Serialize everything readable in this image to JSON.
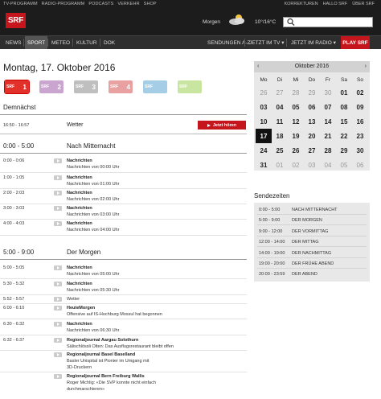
{
  "top_links_left": [
    "TV-PROGRAMM",
    "RADIO-PROGRAMM",
    "PODCASTS",
    "VERKEHR",
    "SHOP"
  ],
  "top_links_right": [
    "KORREKTUREN",
    "HALLO SRF",
    "ÜBER SRF"
  ],
  "logo": "SRF",
  "weather": {
    "label": "Morgen",
    "temp": "10°/16°C",
    "icon": "cloud-sun-icon"
  },
  "search": {
    "placeholder": "",
    "icon": "search-icon"
  },
  "nav_left": [
    "NEWS",
    "SPORT",
    "METEO",
    "KULTUR",
    "DOK"
  ],
  "nav_active": "SPORT",
  "nav_right": [
    "SENDUNGEN A-Z",
    "JETZT IM TV ▾",
    "JETZT IM RADIO ▾"
  ],
  "nav_play": "PLAY SRF",
  "date_title": "Montag, 17. Oktober 2016",
  "channels": [
    {
      "name": "SRF 1",
      "digit": "1"
    },
    {
      "name": "SRF 2",
      "digit": "2"
    },
    {
      "name": "SRF 3",
      "digit": "3"
    },
    {
      "name": "SRF 4",
      "digit": "4"
    },
    {
      "name": "SRF Musikwelle",
      "digit": ""
    },
    {
      "name": "SRF Virus",
      "digit": ""
    }
  ],
  "demnaechst": {
    "heading": "Demnächst",
    "time": "16:50 - 16:57",
    "title": "Wetter",
    "button": "Jetzt hören"
  },
  "block1": {
    "time": "0:00 - 5:00",
    "title": "Nach Mitternacht",
    "rows": [
      {
        "time": "0:00 - 0:06",
        "title": "Nachrichten",
        "sub": "Nachrichten von 00:00 Uhr"
      },
      {
        "time": "1:00 - 1:05",
        "title": "Nachrichten",
        "sub": "Nachrichten von 01:00 Uhr"
      },
      {
        "time": "2:00 - 2:03",
        "title": "Nachrichten",
        "sub": "Nachrichten von 02:00 Uhr"
      },
      {
        "time": "3:00 - 3:03",
        "title": "Nachrichten",
        "sub": "Nachrichten von 03:00 Uhr"
      },
      {
        "time": "4:00 - 4:03",
        "title": "Nachrichten",
        "sub": "Nachrichten von 04:00 Uhr"
      }
    ]
  },
  "block2": {
    "time": "5:00 - 9:00",
    "title": "Der Morgen",
    "rows": [
      {
        "time": "5:00 - 5:05",
        "title": "Nachrichten",
        "sub": "Nachrichten von 05:00 Uhr"
      },
      {
        "time": "5:30 - 5:32",
        "title": "Nachrichten",
        "sub": "Nachrichten von 05:30 Uhr"
      },
      {
        "time": "5:52 - 5:57",
        "title": "",
        "sub": "Wetter"
      },
      {
        "time": "6:00 - 6:10",
        "title": "HeuteMorgen",
        "sub": "Offensive auf IS-Hochburg Mossul hat begonnen"
      },
      {
        "time": "6:30 - 6:32",
        "title": "Nachrichten",
        "sub": "Nachrichten von 06:30 Uhr"
      },
      {
        "time": "6:32 - 6:37",
        "title": "Regionaljournal Aargau Solothurn",
        "sub": "Sälischlössli Olten: Das Ausflugsrestaurant bleibt offen"
      },
      {
        "time": "",
        "title": "Regionaljournal Basel Baselland",
        "sub": "Basler Unispital ist Pionier im Umgang mit",
        "sub2": "3D-Druckern"
      },
      {
        "time": "",
        "title": "Regionaljournal Bern Freiburg Wallis",
        "sub": "Roger Michlig: «Die SVP konnte nicht einfach",
        "sub2": "durchmarschieren»"
      }
    ]
  },
  "calendar": {
    "title": "Oktober 2016",
    "prev": "‹",
    "next": "›",
    "weekdays": [
      "Mo",
      "Di",
      "Mi",
      "Do",
      "Fr",
      "Sa",
      "So"
    ],
    "weeks": [
      [
        "26",
        "27",
        "28",
        "29",
        "30",
        "01",
        "02"
      ],
      [
        "03",
        "04",
        "05",
        "06",
        "07",
        "08",
        "09"
      ],
      [
        "10",
        "11",
        "12",
        "13",
        "14",
        "15",
        "16"
      ],
      [
        "17",
        "18",
        "19",
        "20",
        "21",
        "22",
        "23"
      ],
      [
        "24",
        "25",
        "26",
        "27",
        "28",
        "29",
        "30"
      ],
      [
        "31",
        "01",
        "02",
        "03",
        "04",
        "05",
        "06"
      ]
    ],
    "today": "17"
  },
  "sendezeiten": {
    "heading": "Sendezeiten",
    "rows": [
      {
        "time": "0:00 - 5:00",
        "name": "NACH MITTERNACHT"
      },
      {
        "time": "5:00 - 9:00",
        "name": "DER MORGEN"
      },
      {
        "time": "9:00 - 12:00",
        "name": "DER VORMITTAG"
      },
      {
        "time": "12:00 - 14:00",
        "name": "DER MITTAG"
      },
      {
        "time": "14:00 - 19:00",
        "name": "DER NACHMITTAG"
      },
      {
        "time": "19:00 - 20:00",
        "name": "DER FRÜHE ABEND"
      },
      {
        "time": "20:00 - 23:59",
        "name": "DER ABEND"
      }
    ]
  }
}
